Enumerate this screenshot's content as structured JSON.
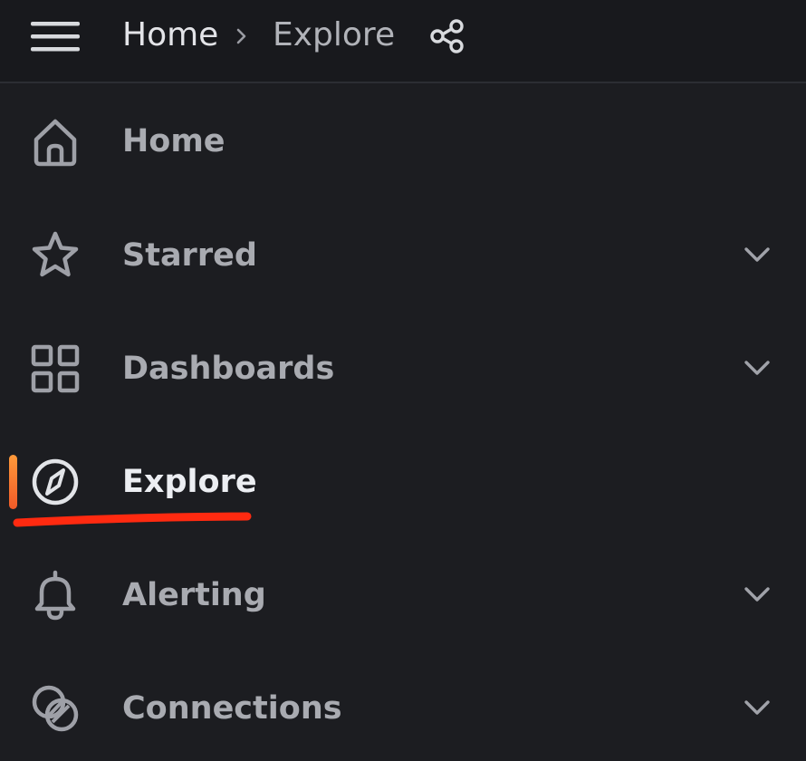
{
  "topbar": {
    "breadcrumb_home": "Home",
    "breadcrumb_current": "Explore"
  },
  "nav": {
    "items": [
      {
        "label": "Home",
        "icon": "home-icon",
        "expandable": false,
        "active": false
      },
      {
        "label": "Starred",
        "icon": "star-icon",
        "expandable": true,
        "active": false
      },
      {
        "label": "Dashboards",
        "icon": "apps-grid-icon",
        "expandable": true,
        "active": false
      },
      {
        "label": "Explore",
        "icon": "compass-icon",
        "expandable": false,
        "active": true
      },
      {
        "label": "Alerting",
        "icon": "bell-icon",
        "expandable": true,
        "active": false
      },
      {
        "label": "Connections",
        "icon": "connections-icon",
        "expandable": true,
        "active": false
      }
    ]
  },
  "colors": {
    "background": "#1c1d21",
    "topbar": "#18191d",
    "text_primary": "#e3e4e8",
    "text_secondary": "#a9abb1",
    "active_indicator": "#f05a28",
    "annotation_underline": "#ff2a10"
  }
}
